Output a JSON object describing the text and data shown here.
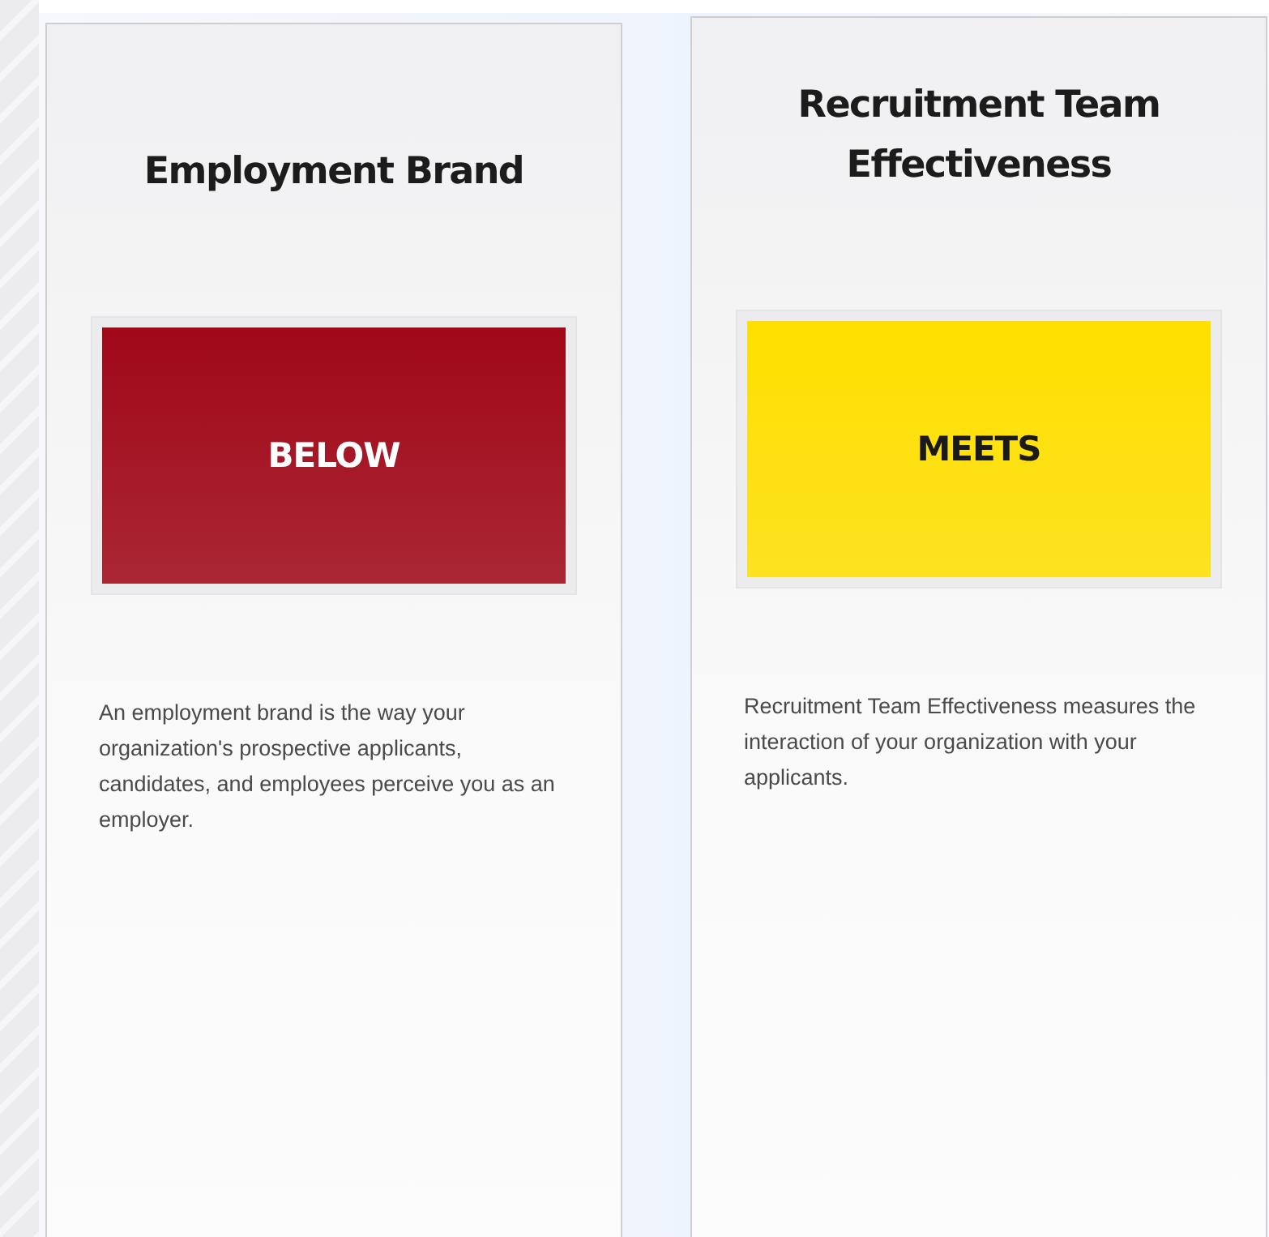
{
  "cards": [
    {
      "title": "Employment Brand",
      "status": {
        "label": "BELOW",
        "color": "#a00818"
      },
      "description": "An employment brand is the way your organization's prospective applicants, candidates, and employees perceive you as an employer."
    },
    {
      "title": "Recruitment Team Effectiveness",
      "status": {
        "label": "MEETS",
        "color": "#ffe000"
      },
      "description": "Recruitment Team Effectiveness measures the interaction of your organization with your applicants."
    }
  ]
}
